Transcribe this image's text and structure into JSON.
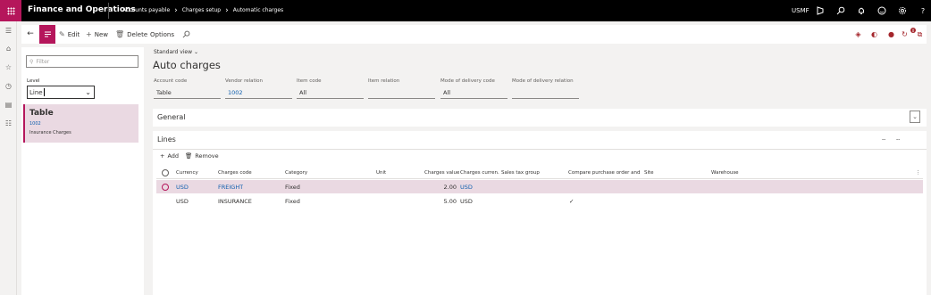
{
  "topbar": {
    "app_name": "Finance and Operations",
    "breadcrumbs": [
      "Accounts payable",
      "Charges setup",
      "Automatic charges"
    ],
    "company": "USMF",
    "icons": [
      "waffle-icon",
      "dynamics-icon",
      "search-icon",
      "bell-icon",
      "smiley-icon",
      "gear-icon",
      "help-icon"
    ]
  },
  "actions": {
    "edit": "Edit",
    "new": "New",
    "delete": "Delete",
    "options": "Options"
  },
  "notifications_count": "0",
  "left_pane": {
    "filter_placeholder": "Filter",
    "level_label": "Level",
    "level_value": "Line",
    "card": {
      "title": "Table",
      "code": "1002",
      "description": "Insurance Charges"
    }
  },
  "view_selector": "Standard view",
  "page_title": "Auto charges",
  "header_fields": [
    {
      "label": "Account code",
      "value": "Table"
    },
    {
      "label": "Vendor relation",
      "value": "1002"
    },
    {
      "label": "Item code",
      "value": "All"
    },
    {
      "label": "Item relation",
      "value": ""
    },
    {
      "label": "Mode of delivery code",
      "value": "All"
    },
    {
      "label": "Mode of delivery relation",
      "value": ""
    }
  ],
  "sections": {
    "general": "General",
    "lines": "Lines",
    "add": "Add",
    "remove": "Remove",
    "lines_dash1": "--",
    "lines_dash2": "--"
  },
  "grid": {
    "columns": [
      "Currency",
      "Charges code",
      "Category",
      "Unit",
      "Charges value",
      "Charges curren...",
      "Sales tax group",
      "Compare purchase order and i...",
      "Site",
      "Warehouse"
    ],
    "rows": [
      {
        "currency": "USD",
        "charges_code": "FREIGHT",
        "category": "Fixed",
        "unit": "",
        "charges_value": "2.00",
        "charges_currency": "USD",
        "sales_tax_group": "",
        "compare": "",
        "site": "",
        "warehouse": "",
        "selected": true
      },
      {
        "currency": "USD",
        "charges_code": "INSURANCE",
        "category": "Fixed",
        "unit": "",
        "charges_value": "5.00",
        "charges_currency": "USD",
        "sales_tax_group": "",
        "compare": "✓",
        "site": "",
        "warehouse": "",
        "selected": false
      }
    ]
  },
  "colors": {
    "accent": "#b5165b",
    "selected_row": "#ead9e2",
    "link": "#0f5fae"
  }
}
